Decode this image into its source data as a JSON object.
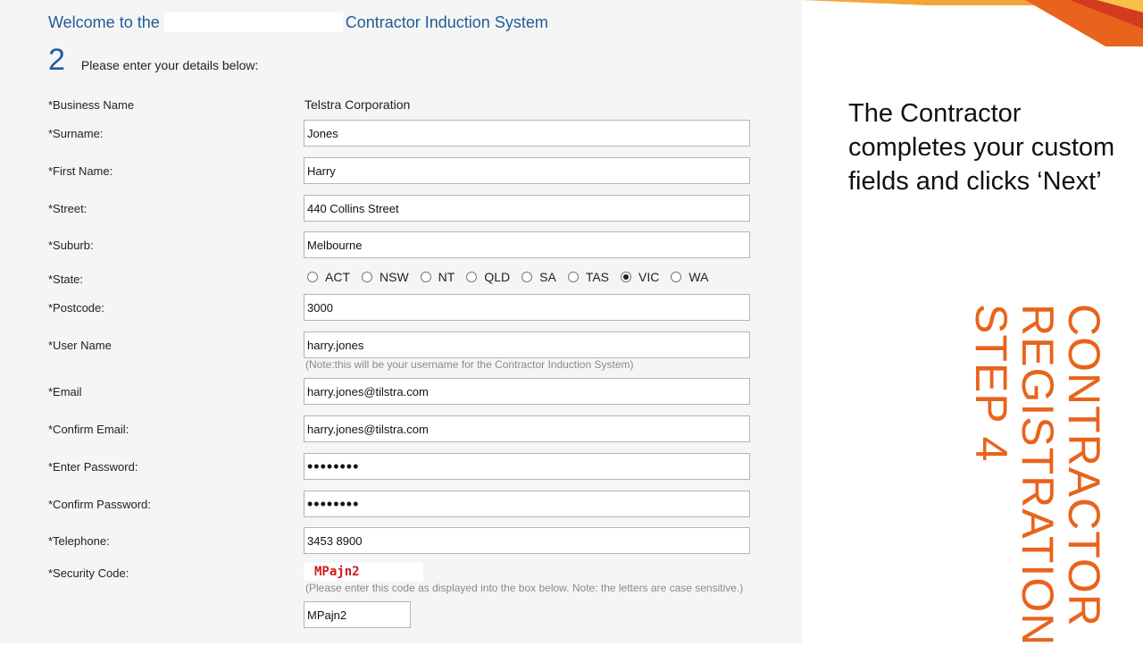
{
  "header": {
    "welcome_prefix": "Welcome to the",
    "welcome_suffix": "Contractor Induction System",
    "step_number": "2",
    "step_text": "Please enter your details below:"
  },
  "form": {
    "business_name": {
      "label": "*Business Name",
      "value": "Telstra Corporation"
    },
    "surname": {
      "label": "*Surname:",
      "value": "Jones"
    },
    "first_name": {
      "label": "*First Name:",
      "value": "Harry"
    },
    "street": {
      "label": "*Street:",
      "value": "440 Collins Street"
    },
    "suburb": {
      "label": "*Suburb:",
      "value": "Melbourne"
    },
    "state": {
      "label": "*State:",
      "options": [
        "ACT",
        "NSW",
        "NT",
        "QLD",
        "SA",
        "TAS",
        "VIC",
        "WA"
      ],
      "selected": "VIC"
    },
    "postcode": {
      "label": "*Postcode:",
      "value": "3000"
    },
    "username": {
      "label": "*User Name",
      "value": "harry.jones",
      "note": "(Note:this will be your username for the Contractor Induction System)"
    },
    "email": {
      "label": "*Email",
      "value": "harry.jones@tilstra.com"
    },
    "confirm_email": {
      "label": "*Confirm Email:",
      "value": "harry.jones@tilstra.com"
    },
    "password": {
      "label": "*Enter Password:",
      "value": "••••••••"
    },
    "confirm_password": {
      "label": "*Confirm Password:",
      "value": "••••••••"
    },
    "telephone": {
      "label": "*Telephone:",
      "value": "3453 8900"
    },
    "security_code": {
      "label": "*Security Code:",
      "captcha": "MPajn2",
      "note": "(Please enter this code as displayed into the box below. Note: the letters are case sensitive.)",
      "value": "MPajn2"
    }
  },
  "slide": {
    "description": "The Contractor completes your custom fields and clicks ‘Next’",
    "title_lines": [
      "Contractor",
      "Registration",
      "Step 4"
    ],
    "accent_color": "#e8641c"
  }
}
